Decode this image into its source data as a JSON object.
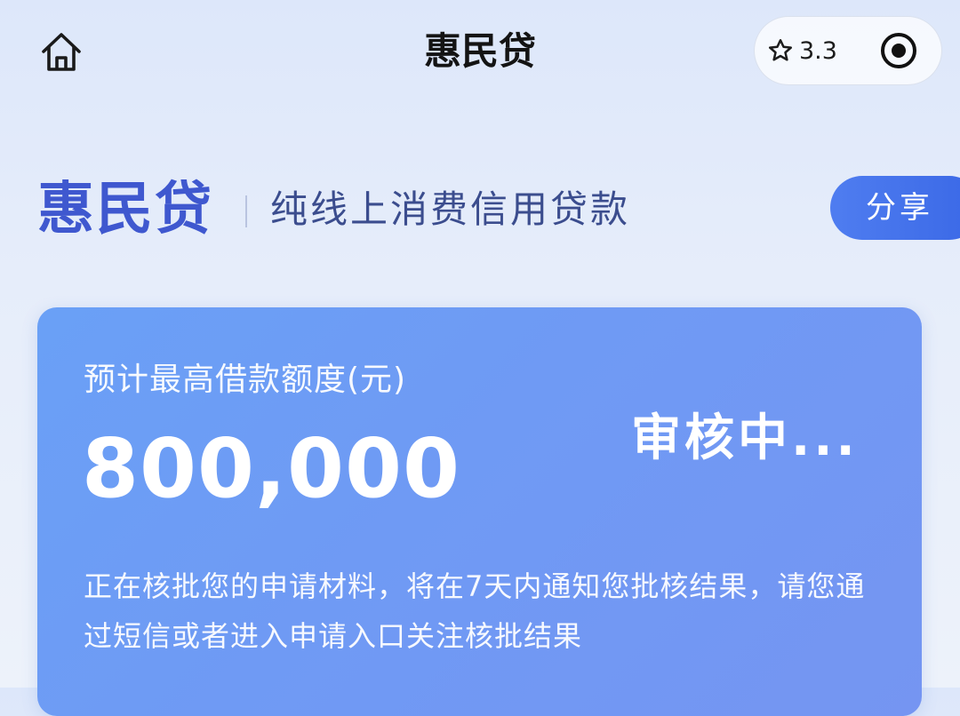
{
  "nav": {
    "title": "惠民贷",
    "rating": "3.3",
    "icons": {
      "home": "home-icon",
      "star": "star-outline-icon",
      "target": "target-icon"
    }
  },
  "brand": {
    "name": "惠民贷",
    "slogan": "纯线上消费信用贷款",
    "share_label": "分享"
  },
  "card": {
    "label": "预计最高借款额度(元)",
    "amount": "800,000",
    "status": "审核中...",
    "description": "正在核批您的申请材料，将在7天内通知您批核结果，请您通过短信或者进入申请入口关注核批结果"
  },
  "colors": {
    "brand_blue": "#3f58cf",
    "card_blue": "#6f9af4",
    "share_blue": "#3a68e6",
    "background": "#e6edfa"
  }
}
